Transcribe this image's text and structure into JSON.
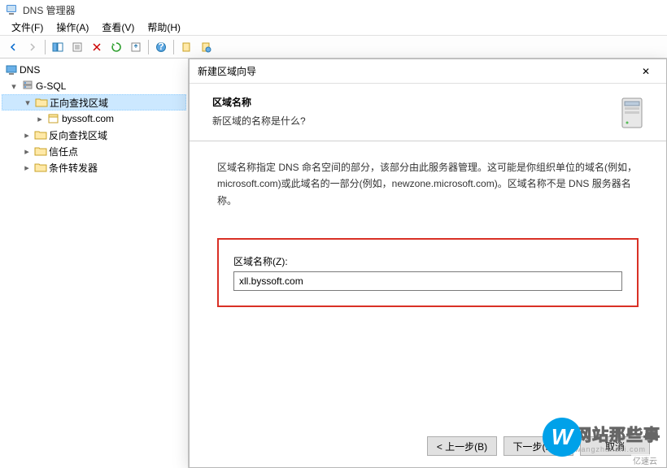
{
  "app": {
    "title": "DNS 管理器"
  },
  "menu": {
    "file": "文件(F)",
    "action": "操作(A)",
    "view": "查看(V)",
    "help": "帮助(H)"
  },
  "tree": {
    "root": "DNS",
    "server": "G-SQL",
    "fwd": "正向查找区域",
    "fwd_item": "byssoft.com",
    "rev": "反向查找区域",
    "trust": "信任点",
    "cond": "条件转发器"
  },
  "wizard": {
    "window_title": "新建区域向导",
    "heading": "区域名称",
    "subheading": "新区域的名称是什么?",
    "description": "区域名称指定 DNS 命名空间的部分，该部分由此服务器管理。这可能是你组织单位的域名(例如，microsoft.com)或此域名的一部分(例如，newzone.microsoft.com)。区域名称不是 DNS 服务器名称。",
    "field_label": "区域名称(Z):",
    "field_value": "xll.byssoft.com",
    "back": "< 上一步(B)",
    "next": "下一步(N) >",
    "cancel": "取消"
  },
  "watermark": {
    "letter": "W",
    "text": "网站那些事",
    "url": "wangzhanshi.com"
  },
  "stamp": "亿速云"
}
